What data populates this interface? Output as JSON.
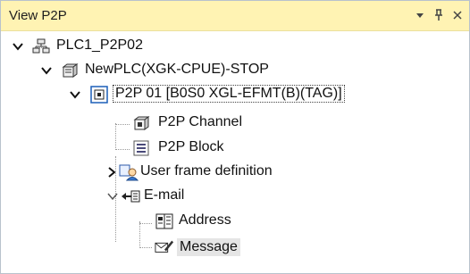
{
  "panel": {
    "title": "View P2P",
    "buttons": {
      "menu_icon": "dropdown-triangle",
      "pin_icon": "pin",
      "close_icon": "close-x"
    }
  },
  "tree": {
    "root": {
      "label": "PLC1_P2P02",
      "expanded": true,
      "icon": "network-icon"
    },
    "plc": {
      "label": "NewPLC(XGK-CPUE)-STOP",
      "expanded": true,
      "icon": "plc-module-icon"
    },
    "p2p": {
      "label": "P2P 01 [B0S0 XGL-EFMT(B)(TAG)]",
      "expanded": true,
      "icon": "comm-module-icon"
    },
    "items": [
      {
        "label": "P2P Channel",
        "icon": "channel-icon"
      },
      {
        "label": "P2P Block",
        "icon": "block-icon"
      },
      {
        "label": "User frame definition",
        "icon": "user-frame-icon",
        "collapsed": true
      },
      {
        "label": "E-mail",
        "icon": "email-icon",
        "expanded": true
      },
      {
        "label": "Address",
        "icon": "address-book-icon"
      },
      {
        "label": "Message",
        "icon": "message-edit-icon",
        "selected": true
      }
    ]
  },
  "colors": {
    "titlebar_bg": "#fff3b3",
    "selection_bg": "#e5e5e5",
    "border": "#b9c2cc"
  }
}
